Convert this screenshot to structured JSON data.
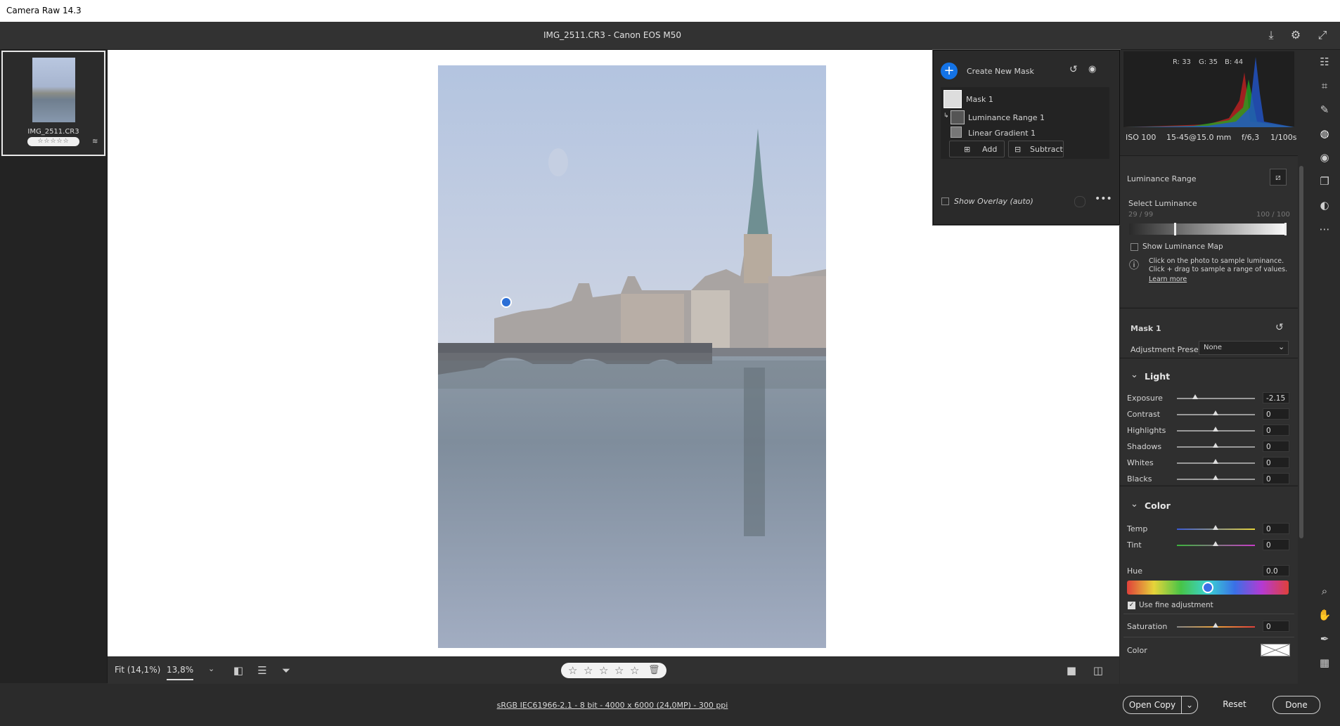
{
  "app": {
    "title": "Camera Raw 14.3"
  },
  "header": {
    "file_title": "IMG_2511.CR3  -  Canon EOS M50"
  },
  "filmstrip": {
    "filename": "IMG_2511.CR3",
    "stars": "☆☆☆☆☆"
  },
  "bottombar": {
    "fit_label": "Fit (14,1%)",
    "zoom_label": "13,8%",
    "rating_stars": [
      "☆",
      "☆",
      "☆",
      "☆",
      "☆"
    ]
  },
  "status": {
    "workflow_options": "sRGB IEC61966-2.1 - 8 bit - 4000 x 6000 (24,0MP) - 300 ppi",
    "open_copy": "Open Copy",
    "reset": "Reset",
    "done": "Done"
  },
  "mask_panel": {
    "create_new_mask": "Create New Mask",
    "mask_name": "Mask 1",
    "components": [
      "Luminance Range 1",
      "Linear Gradient 1"
    ],
    "add_label": "Add",
    "subtract_label": "Subtract",
    "show_overlay": "Show Overlay (auto)"
  },
  "histogram": {
    "r": "R: 33",
    "g": "G: 35",
    "b": "B: 44"
  },
  "camera_info": {
    "iso": "ISO 100",
    "lens": "15-45@15.0 mm",
    "aperture": "f/6,3",
    "shutter": "1/100s"
  },
  "luminance": {
    "title": "Luminance Range",
    "select_label": "Select Luminance",
    "range_low": "29 / 99",
    "range_high": "100 / 100",
    "show_map": "Show Luminance Map",
    "info_text_1": "Click on the photo to sample luminance.",
    "info_text_2": "Click + drag to sample a range of values.",
    "learn_more": "Learn more"
  },
  "mask1": {
    "title": "Mask 1",
    "preset_label": "Adjustment Preset",
    "preset_value": "None"
  },
  "light": {
    "title": "Light",
    "sliders": [
      {
        "label": "Exposure",
        "value": "-2.15"
      },
      {
        "label": "Contrast",
        "value": "0"
      },
      {
        "label": "Highlights",
        "value": "0"
      },
      {
        "label": "Shadows",
        "value": "0"
      },
      {
        "label": "Whites",
        "value": "0"
      },
      {
        "label": "Blacks",
        "value": "0"
      }
    ]
  },
  "color": {
    "title": "Color",
    "temp_label": "Temp",
    "temp_value": "0",
    "tint_label": "Tint",
    "tint_value": "0",
    "hue_label": "Hue",
    "hue_value": "0.0",
    "fine_adjust": "Use fine adjustment",
    "saturation_label": "Saturation",
    "saturation_value": "0",
    "color_label": "Color"
  },
  "colors": {
    "accent": "#1473e6",
    "panel": "#2f2f2f",
    "canvas": "#ffffff"
  },
  "icons": [
    "download-icon",
    "gear-icon",
    "fullscreen-icon",
    "edit-sliders-icon",
    "crop-icon",
    "healing-icon",
    "masking-icon",
    "redeye-icon",
    "snapshots-icon",
    "presets-icon",
    "more-icon",
    "zoom-icon",
    "hand-icon",
    "color-sampler-icon",
    "grid-icon"
  ]
}
